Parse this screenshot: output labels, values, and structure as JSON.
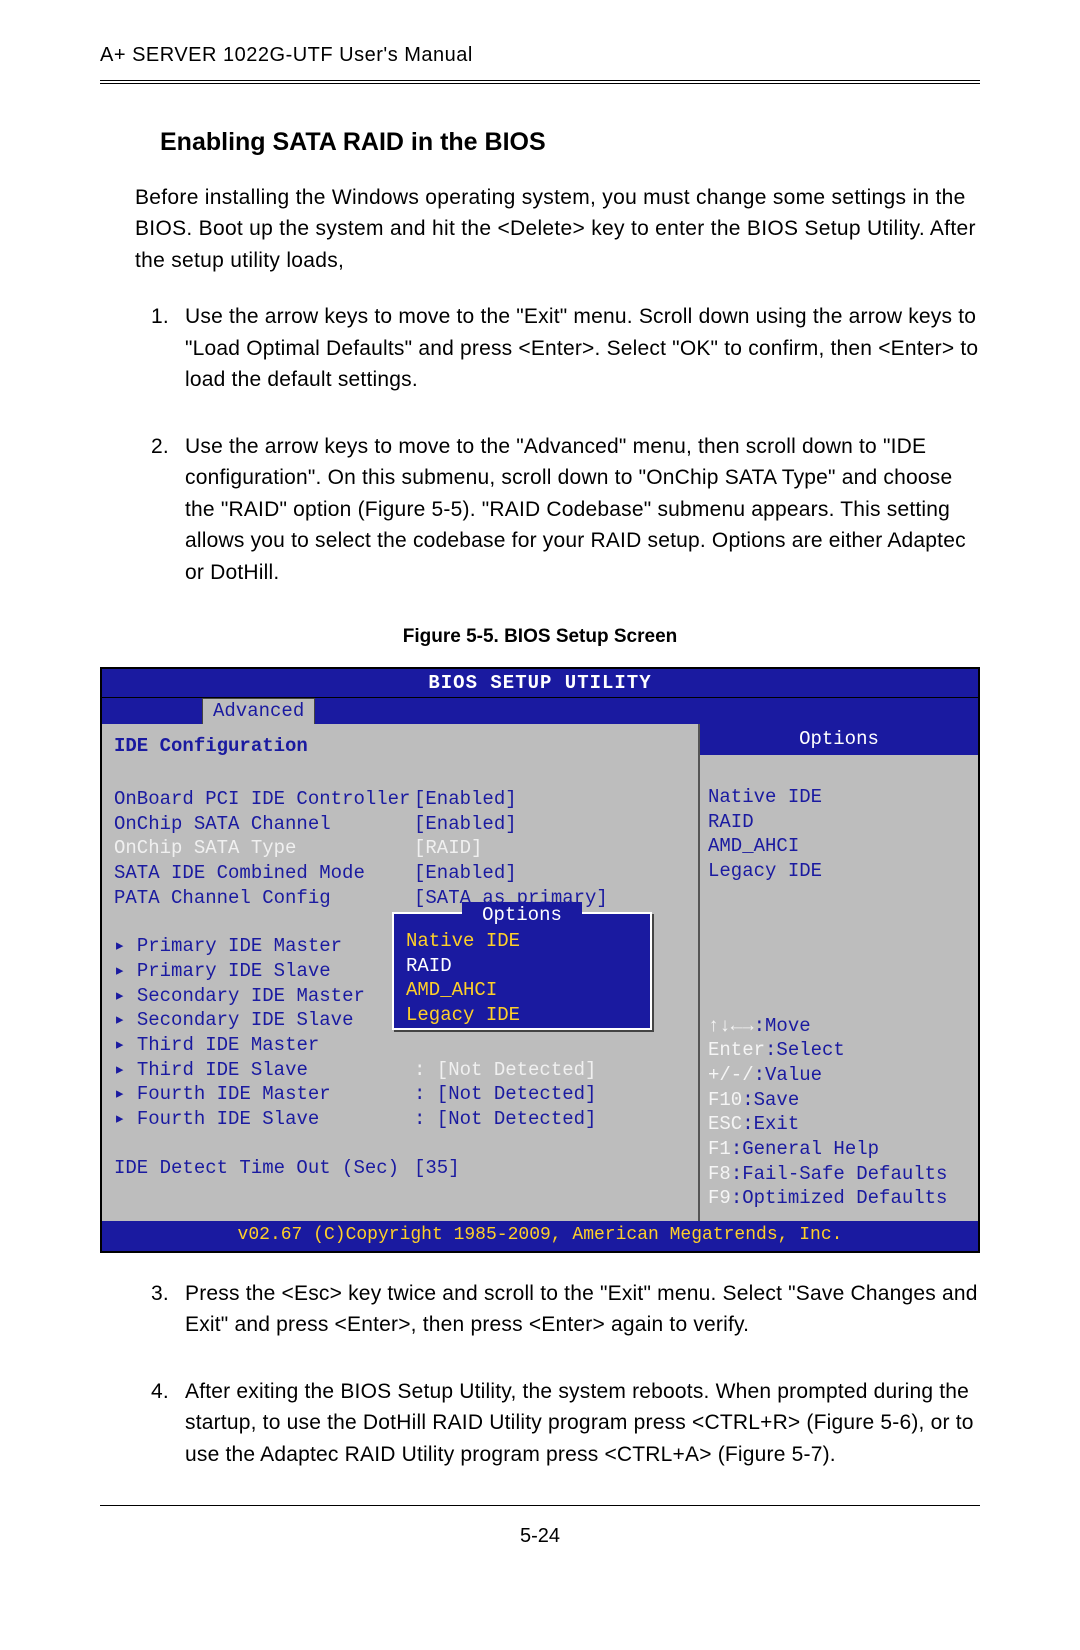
{
  "header": "A+ SERVER 1022G-UTF User's Manual",
  "section_title": "Enabling SATA RAID in the BIOS",
  "intro": "Before installing the Windows operating system, you must change some settings in the BIOS. Boot up the system and hit the <Delete> key to enter the BIOS Setup Utility. After the setup utility loads,",
  "steps": {
    "s1": "Use the arrow keys to move to the \"Exit\" menu. Scroll down using the arrow keys to \"Load Optimal Defaults\" and press <Enter>. Select \"OK\" to confirm, then <Enter> to load the default settings.",
    "s2": "Use the arrow keys to move to the \"Advanced\" menu, then scroll down to \"IDE configuration\". On this submenu, scroll down to \"OnChip SATA Type\" and choose the \"RAID\" option (Figure 5-5). \"RAID Codebase\" submenu appears. This setting allows you to select the codebase for your RAID setup. Options are either Adaptec or DotHill.",
    "s3": "Press the <Esc> key twice and scroll to the \"Exit\" menu. Select \"Save Changes and Exit\" and press <Enter>, then press <Enter> again to verify.",
    "s4": "After exiting the BIOS Setup Utility, the system reboots. When prompted during the startup, to use the DotHill RAID Utility program press <CTRL+R> (Figure 5-6), or to use the Adaptec RAID Utility program press <CTRL+A> (Figure 5-7)."
  },
  "figure_caption": "Figure 5-5. BIOS Setup Screen",
  "bios": {
    "title": "BIOS SETUP UTILITY",
    "tab": "Advanced",
    "left": {
      "heading": "IDE Configuration",
      "rows": [
        {
          "label": "OnBoard PCI IDE Controller",
          "value": "[Enabled]"
        },
        {
          "label": "OnChip SATA Channel",
          "value": "[Enabled]"
        },
        {
          "label": "OnChip SATA Type",
          "value": "[RAID]",
          "hl": true
        },
        {
          "label": "SATA IDE Combined Mode",
          "value": "[Enabled]"
        },
        {
          "label": "PATA Channel Config",
          "value": "[SATA as primary]"
        }
      ],
      "ide_rows": [
        {
          "label": "Primary IDE Master",
          "value": ""
        },
        {
          "label": "Primary IDE Slave",
          "value": ""
        },
        {
          "label": "Secondary IDE Master",
          "value": ""
        },
        {
          "label": "Secondary IDE Slave",
          "value": ""
        },
        {
          "label": "Third IDE Master",
          "value": ""
        },
        {
          "label": "Third IDE Slave",
          "value": ": [Not Detected]",
          "gray": true
        },
        {
          "label": "Fourth IDE Master",
          "value": ": [Not Detected]"
        },
        {
          "label": "Fourth IDE Slave",
          "value": ": [Not Detected]"
        }
      ],
      "timeout": {
        "label": "IDE Detect Time Out (Sec)",
        "value": "[35]"
      }
    },
    "popup": {
      "title": "Options",
      "items": [
        "Native IDE",
        "RAID",
        "AMD_AHCI",
        "Legacy IDE"
      ],
      "selected": "RAID"
    },
    "right": {
      "header": "Options",
      "options": [
        "Native IDE",
        "RAID",
        "AMD_AHCI",
        "Legacy IDE"
      ],
      "nav": [
        {
          "k": "↑↓←→",
          "v": ":Move"
        },
        {
          "k": "Enter",
          "v": ":Select"
        },
        {
          "k": "+/-/",
          "v": ":Value"
        },
        {
          "k": "F10",
          "v": ":Save"
        },
        {
          "k": "ESC",
          "v": ":Exit"
        },
        {
          "k": "F1",
          "v": ":General Help"
        },
        {
          "k": "F8",
          "v": ":Fail-Safe Defaults"
        },
        {
          "k": "F9",
          "v": ":Optimized Defaults"
        }
      ]
    },
    "footer": "v02.67 (C)Copyright 1985-2009, American Megatrends, Inc."
  },
  "page_num": "5-24"
}
